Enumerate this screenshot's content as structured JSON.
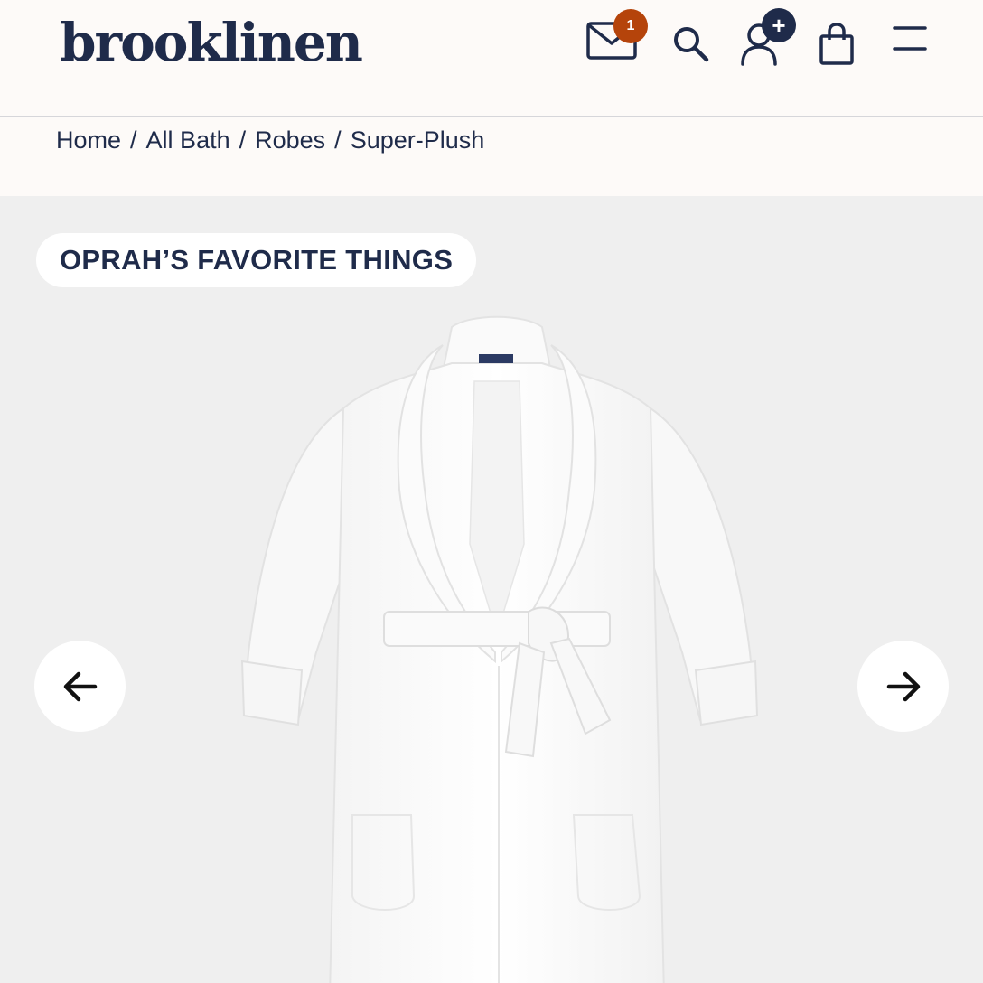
{
  "header": {
    "logo": "brooklinen",
    "icons": {
      "mail": "mail-icon",
      "search": "search-icon",
      "account": "user-icon",
      "cart": "shopping-bag-icon",
      "menu": "hamburger-menu-icon"
    },
    "mail_badge": "1",
    "account_badge": "+",
    "mail_badge_color": "#b5440b",
    "account_badge_color": "#1f2b4a"
  },
  "breadcrumb": {
    "items": [
      "Home",
      "All Bath",
      "Robes",
      "Super-Plush"
    ],
    "separator": "/"
  },
  "gallery": {
    "badge_label": "OPRAH’S FAVORITE THINGS",
    "image_alt": "white-plush-robe",
    "prev_icon": "arrow-left-icon",
    "next_icon": "arrow-right-icon"
  },
  "colors": {
    "navy": "#1f2b4a",
    "header_bg": "#fdfaf8",
    "gallery_bg": "#efefef"
  }
}
